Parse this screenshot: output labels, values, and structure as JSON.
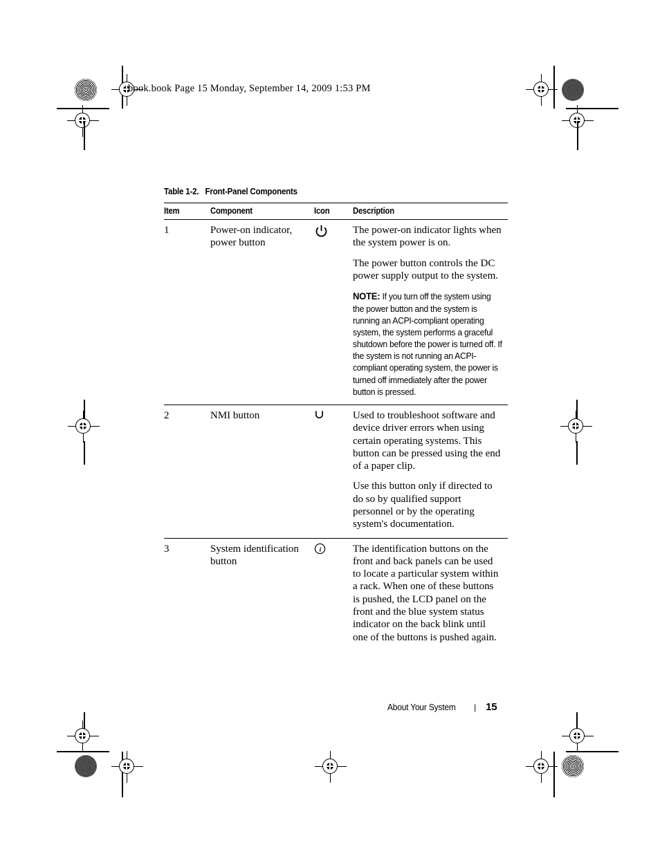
{
  "document": {
    "running_header": "book.book  Page 15  Monday, September 14, 2009  1:53 PM",
    "footer": {
      "section": "About Your System",
      "separator": "|",
      "page_number": "15"
    }
  },
  "table": {
    "caption_number": "Table 1-2.",
    "caption_title": "Front-Panel Components",
    "headers": {
      "item": "Item",
      "component": "Component",
      "icon": "Icon",
      "description": "Description"
    },
    "rows": [
      {
        "item": "1",
        "component": "Power-on indicator, power button",
        "icon_name": "power-icon",
        "paragraphs": [
          "The power-on indicator lights when the system power is on.",
          "The power button controls the DC power supply output to the system."
        ],
        "note_label": "NOTE:",
        "note_text": " If you turn off the system using the power button and the system is running an ACPI-compliant operating system, the system performs a graceful shutdown before the power is turned off. If the system is not running an ACPI-compliant operating system, the power is turned off immediately after the power button is pressed."
      },
      {
        "item": "2",
        "component": "NMI button",
        "icon_name": "nmi-icon",
        "paragraphs": [
          "Used to troubleshoot software and device driver errors when using certain operating systems. This button can be pressed using the end of a paper clip.",
          "Use this button only if directed to do so by qualified support personnel or by the operating system's documentation."
        ]
      },
      {
        "item": "3",
        "component": "System identification button",
        "icon_name": "identification-icon",
        "paragraphs": [
          "The identification buttons on the front and back panels can be used to locate a particular system within a rack. When one of these buttons is pushed, the LCD panel on the front and the blue system status indicator on the back blink until one of the buttons is pushed again."
        ]
      }
    ]
  },
  "colors": {
    "text": "#000000",
    "background": "#ffffff",
    "rule": "#000000"
  }
}
